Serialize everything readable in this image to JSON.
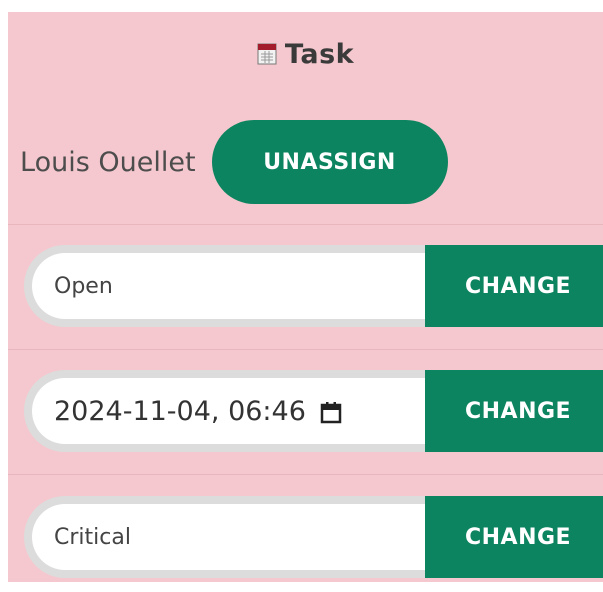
{
  "header": {
    "icon": "task-icon",
    "title": "Task"
  },
  "assignment": {
    "assignee": "Louis Ouellet",
    "unassign_label": "UNASSIGN"
  },
  "fields": {
    "status": {
      "value": "Open",
      "button_label": "CHANGE"
    },
    "due_date": {
      "value": "2024-11-04, 06:46",
      "icon": "calendar-icon",
      "button_label": "CHANGE"
    },
    "priority": {
      "value": "Critical",
      "button_label": "CHANGE"
    }
  },
  "colors": {
    "panel_background": "#f4c8ce",
    "accent": "#0d8460"
  }
}
